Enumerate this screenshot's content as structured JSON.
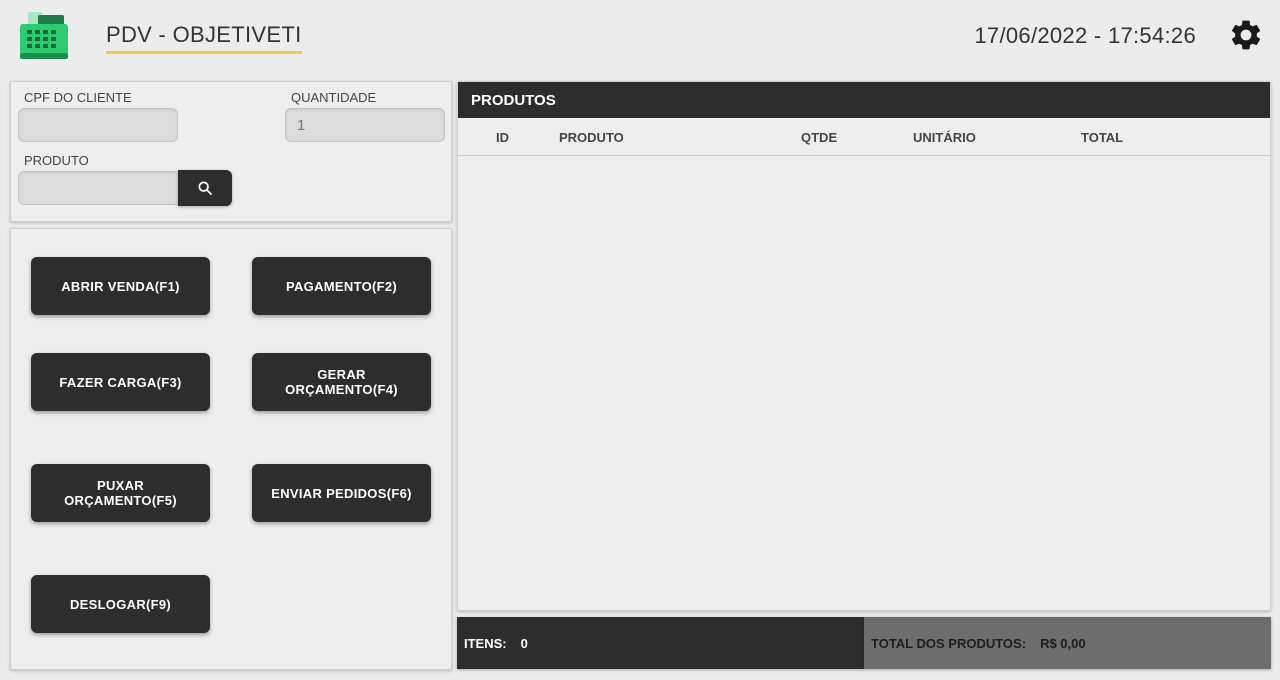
{
  "header": {
    "title": "PDV - OBJETIVETI",
    "datetime": "17/06/2022 - 17:54:26",
    "logo_icon": "cash-register-icon",
    "settings_icon": "gear-icon"
  },
  "form": {
    "cpf_label": "CPF DO CLIENTE",
    "cpf_value": "",
    "quantity_label": "QUANTIDADE",
    "quantity_value": "1",
    "product_label": "PRODUTO",
    "product_value": "",
    "search_icon": "search-icon"
  },
  "actions": {
    "open_sale": "ABRIR VENDA(F1)",
    "payment": "PAGAMENTO(F2)",
    "load": "FAZER CARGA(F3)",
    "generate_quote": "GERAR ORÇAMENTO(F4)",
    "pull_quote": "PUXAR ORÇAMENTO(F5)",
    "send_orders": "ENVIAR PEDIDOS(F6)",
    "logout": "DESLOGAR(F9)"
  },
  "products": {
    "title": "PRODUTOS",
    "columns": [
      "ID",
      "PRODUTO",
      "QTDE",
      "UNITÁRIO",
      "TOTAL"
    ],
    "rows": []
  },
  "footer": {
    "items_label": "ITENS:",
    "items_value": "0",
    "total_label": "TOTAL DOS PRODUTOS:",
    "total_value": "R$ 0,00"
  },
  "colors": {
    "dark": "#2d2d2d",
    "background": "#ececec",
    "accent_underline": "#f2c94c",
    "logo_green": "#2ecc71",
    "footer_gray": "#6d6d6d"
  }
}
